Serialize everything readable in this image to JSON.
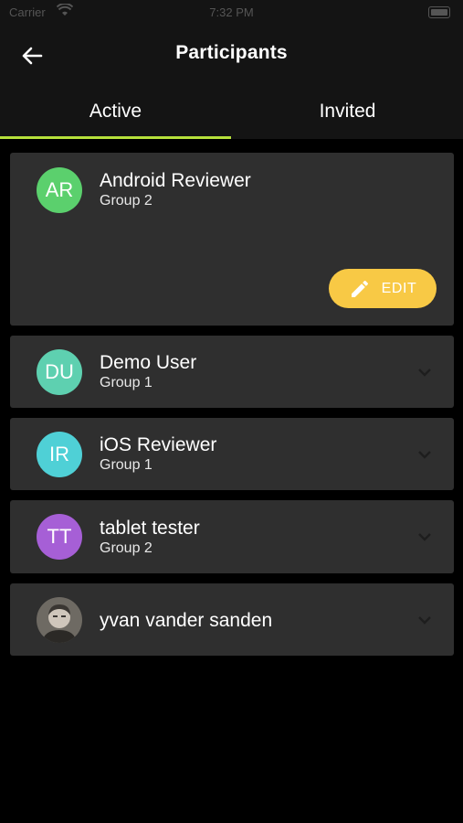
{
  "status_bar": {
    "carrier": "Carrier",
    "time": "7:32 PM"
  },
  "header": {
    "title": "Participants"
  },
  "tabs": [
    {
      "label": "Active",
      "active": true
    },
    {
      "label": "Invited",
      "active": false
    }
  ],
  "colors": {
    "tab_indicator": "#b6e03b",
    "edit_button": "#f8c945",
    "card": "#2f2f2f"
  },
  "participants": [
    {
      "initials": "AR",
      "name": "Android Reviewer",
      "group": "Group 2",
      "avatar_color": "#5bd06d",
      "expanded": true,
      "edit_label": "EDIT"
    },
    {
      "initials": "DU",
      "name": "Demo User",
      "group": "Group 1",
      "avatar_color": "#5ed0b0"
    },
    {
      "initials": "IR",
      "name": "iOS Reviewer",
      "group": "Group 1",
      "avatar_color": "#4fd0d6"
    },
    {
      "initials": "TT",
      "name": "tablet tester",
      "group": "Group 2",
      "avatar_color": "#a65fd6"
    },
    {
      "name": "yvan vander sanden",
      "avatar": "photo"
    }
  ]
}
